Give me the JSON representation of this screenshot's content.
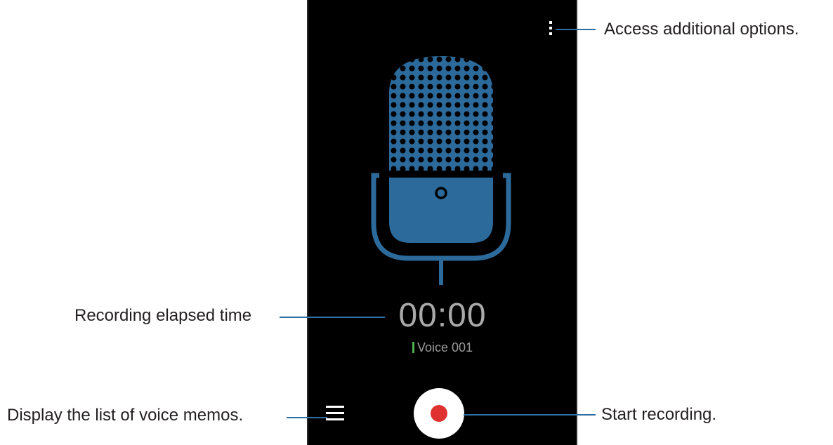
{
  "screen": {
    "timer": "00:00",
    "file_name": "Voice 001"
  },
  "icons": {
    "more_options": "more-vertical-icon",
    "list": "hamburger-list-icon",
    "record": "record-dot-icon",
    "microphone": "microphone-icon"
  },
  "callouts": {
    "options": "Access additional options.",
    "elapsed": "Recording elapsed time",
    "list": "Display the list of voice memos.",
    "record": "Start recording."
  },
  "colors": {
    "mic_blue": "#2b6a9b",
    "mic_dark": "#1c4a70",
    "record_red": "#e03131",
    "name_marker_green": "#4caf50",
    "callout_line": "#2f6ea0"
  }
}
